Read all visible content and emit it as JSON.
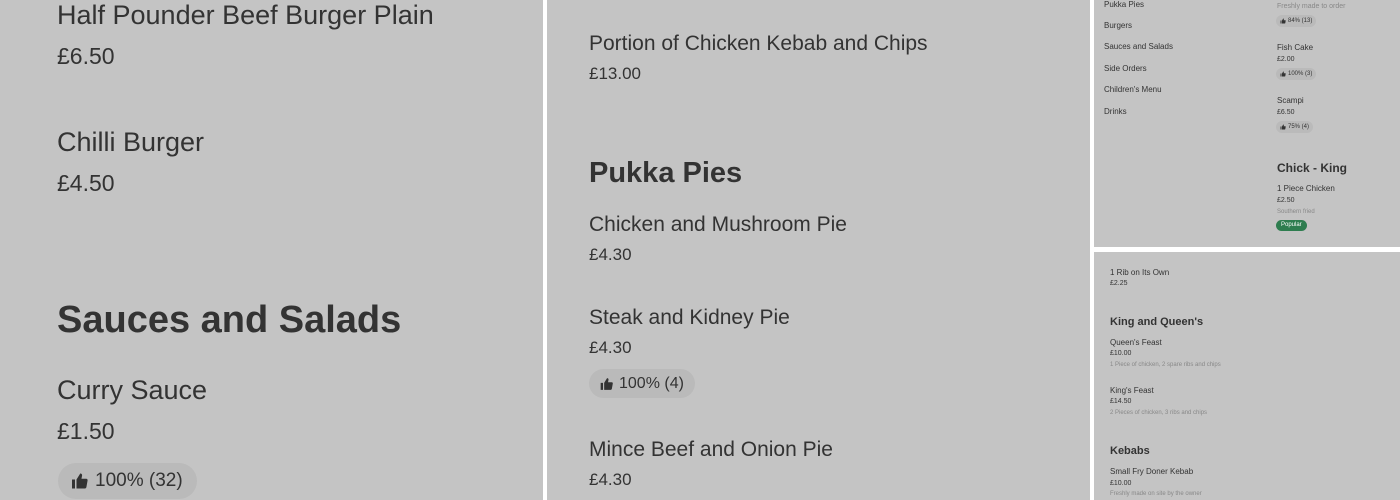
{
  "panel1": {
    "item_half_pounder": {
      "name": "Half Pounder Beef Burger Plain",
      "price": "£6.50"
    },
    "item_chilli_burger": {
      "name": "Chilli Burger",
      "price": "£4.50"
    },
    "section_title": "Sauces and Salads",
    "item_curry_sauce": {
      "name": "Curry Sauce",
      "price": "£1.50",
      "rating": "100% (32)"
    }
  },
  "panel2": {
    "item_kebab_chips": {
      "name": "Portion of Chicken Kebab and Chips",
      "price": "£13.00"
    },
    "section_title": "Pukka Pies",
    "item_chicken_mushroom": {
      "name": "Chicken and Mushroom Pie",
      "price": "£4.30"
    },
    "item_steak_kidney": {
      "name": "Steak and Kidney Pie",
      "price": "£4.30",
      "rating": "100% (4)"
    },
    "item_mince_onion": {
      "name": "Mince Beef and Onion Pie",
      "price": "£4.30"
    }
  },
  "panel3": {
    "nav": [
      "Pukka Pies",
      "Burgers",
      "Sauces and Salads",
      "Side Orders",
      "Children's Menu",
      "Drinks"
    ],
    "top_description": "Freshly made to order",
    "top_rating": "84% (13)",
    "item_fish_cake": {
      "name": "Fish Cake",
      "price": "£2.00",
      "rating": "100% (3)"
    },
    "item_scampi": {
      "name": "Scampi",
      "price": "£6.50",
      "rating": "75% (4)"
    },
    "section_title": "Chick - King",
    "item_one_piece": {
      "name": "1 Piece Chicken",
      "price": "£2.50",
      "description": "Southern fried",
      "badge": "Popular"
    }
  },
  "panel4": {
    "item_rib": {
      "name": "1 Rib on Its Own",
      "price": "£2.25"
    },
    "section_king_queen": "King and Queen's",
    "item_queens_feast": {
      "name": "Queen's Feast",
      "price": "£10.00",
      "description": "1 Piece of chicken, 2 spare ribs and chips"
    },
    "item_kings_feast": {
      "name": "King's Feast",
      "price": "£14.50",
      "description": "2 Pieces of chicken, 3 ribs and chips"
    },
    "section_kebabs": "Kebabs",
    "item_small_fry": {
      "name": "Small Fry Doner Kebab",
      "price": "£10.00",
      "description": "Freshly made on site by the owner"
    }
  },
  "colors": {
    "panel_bg": "#c4c4c4",
    "text": "#333333",
    "muted": "#888888",
    "badge_bg": "#bababa",
    "popular_green": "#2e7d4f"
  },
  "icons": {
    "rating": "thumbs-up-icon"
  }
}
